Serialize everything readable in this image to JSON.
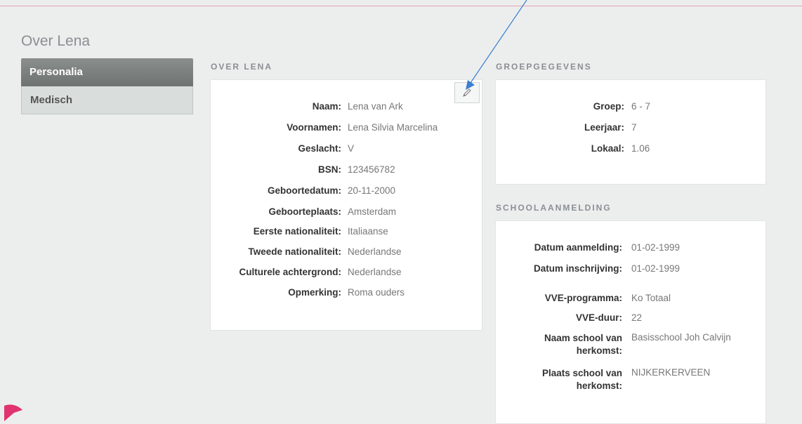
{
  "page_title": "Over Lena",
  "sidebar": {
    "items": [
      {
        "label": "Personalia",
        "active": true
      },
      {
        "label": "Medisch",
        "active": false
      }
    ]
  },
  "over": {
    "title": "OVER LENA",
    "rows": [
      {
        "label": "Naam:",
        "value": "Lena van Ark"
      },
      {
        "label": "Voornamen:",
        "value": "Lena Silvia Marcelina"
      },
      {
        "label": "Geslacht:",
        "value": "V"
      },
      {
        "label": "BSN:",
        "value": "123456782"
      },
      {
        "label": "Geboortedatum:",
        "value": "20-11-2000"
      },
      {
        "label": "Geboorteplaats:",
        "value": "Amsterdam"
      },
      {
        "label": "Eerste nationaliteit:",
        "value": "Italiaanse"
      },
      {
        "label": "Tweede nationaliteit:",
        "value": "Nederlandse"
      },
      {
        "label": "Culturele achtergrond:",
        "value": "Nederlandse"
      },
      {
        "label": "Opmerking:",
        "value": "Roma ouders"
      }
    ]
  },
  "groep": {
    "title": "GROEPGEGEVENS",
    "rows": [
      {
        "label": "Groep:",
        "value": "6 - 7"
      },
      {
        "label": "Leerjaar:",
        "value": "7"
      },
      {
        "label": "Lokaal:",
        "value": "1.06"
      }
    ]
  },
  "school": {
    "title": "SCHOOLAANMELDING",
    "rows": [
      {
        "label": "Datum aanmelding:",
        "value": "01-02-1999"
      },
      {
        "label": "Datum inschrijving:",
        "value": "01-02-1999"
      },
      {
        "label": "VVE-programma:",
        "value": "Ko Totaal"
      },
      {
        "label": "VVE-duur:",
        "value": "22"
      },
      {
        "label": "Naam school van herkomst:",
        "value": "Basisschool Joh Calvijn"
      },
      {
        "label": "Plaats school van herkomst:",
        "value": "NIJKERKERVEEN"
      }
    ]
  },
  "icons": {
    "edit": "pencil-icon"
  },
  "colors": {
    "accent_pink": "#e0336f",
    "annotation_arrow": "#3a7fd0",
    "active_nav": "#7b807f"
  }
}
